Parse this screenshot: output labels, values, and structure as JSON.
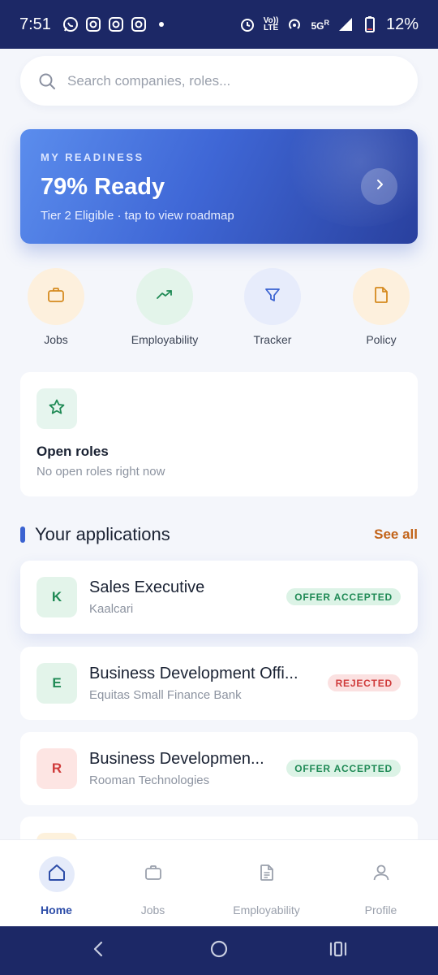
{
  "status_bar": {
    "time": "7:51",
    "network_label_top": "Vo))",
    "network_label_bottom": "LTE",
    "signal_label": "5G",
    "signal_sub": "R",
    "battery": "12%"
  },
  "search": {
    "placeholder": "Search companies, roles..."
  },
  "readiness": {
    "eyebrow": "MY READINESS",
    "title": "79% Ready",
    "subtitle": "Tier 2 Eligible · tap to view roadmap",
    "percent": 79
  },
  "quick_actions": [
    {
      "label": "Jobs",
      "icon": "briefcase-icon",
      "color": "#d58a1e",
      "bg": "#fdf0dd"
    },
    {
      "label": "Employability",
      "icon": "trending-up-icon",
      "color": "#1f8a55",
      "bg": "#e3f4ea"
    },
    {
      "label": "Tracker",
      "icon": "filter-icon",
      "color": "#3b63d1",
      "bg": "#e7ecfb"
    },
    {
      "label": "Policy",
      "icon": "document-icon",
      "color": "#d58a1e",
      "bg": "#fdf0dd"
    }
  ],
  "open_roles": {
    "title": "Open roles",
    "subtitle": "No open roles right now"
  },
  "applications_section": {
    "title": "Your applications",
    "see_all": "See all"
  },
  "applications": [
    {
      "initial": "K",
      "title": "Sales Executive",
      "company": "Kaalcari",
      "status": "OFFER ACCEPTED",
      "status_color": "#1f8a55",
      "avatar_bg": "#e3f4ea",
      "avatar_color": "#1f8a55"
    },
    {
      "initial": "E",
      "title": "Business Development Offi...",
      "company": "Equitas Small Finance Bank",
      "status": "REJECTED",
      "status_color": "#cf3a3a",
      "avatar_bg": "#e3f4ea",
      "avatar_color": "#1f8a55"
    },
    {
      "initial": "R",
      "title": "Business Developmen...",
      "company": "Rooman Technologies",
      "status": "OFFER ACCEPTED",
      "status_color": "#1f8a55",
      "avatar_bg": "#fde5e3",
      "avatar_color": "#cf3a3a"
    }
  ],
  "bottom_nav": [
    {
      "label": "Home",
      "icon": "home-icon",
      "active": true
    },
    {
      "label": "Jobs",
      "icon": "briefcase-icon",
      "active": false
    },
    {
      "label": "Employability",
      "icon": "document-icon",
      "active": false
    },
    {
      "label": "Profile",
      "icon": "user-icon",
      "active": false
    }
  ],
  "colors": {
    "accent": "#3b63d1",
    "system_bar": "#1c2866",
    "see_all": "#c2641a"
  }
}
